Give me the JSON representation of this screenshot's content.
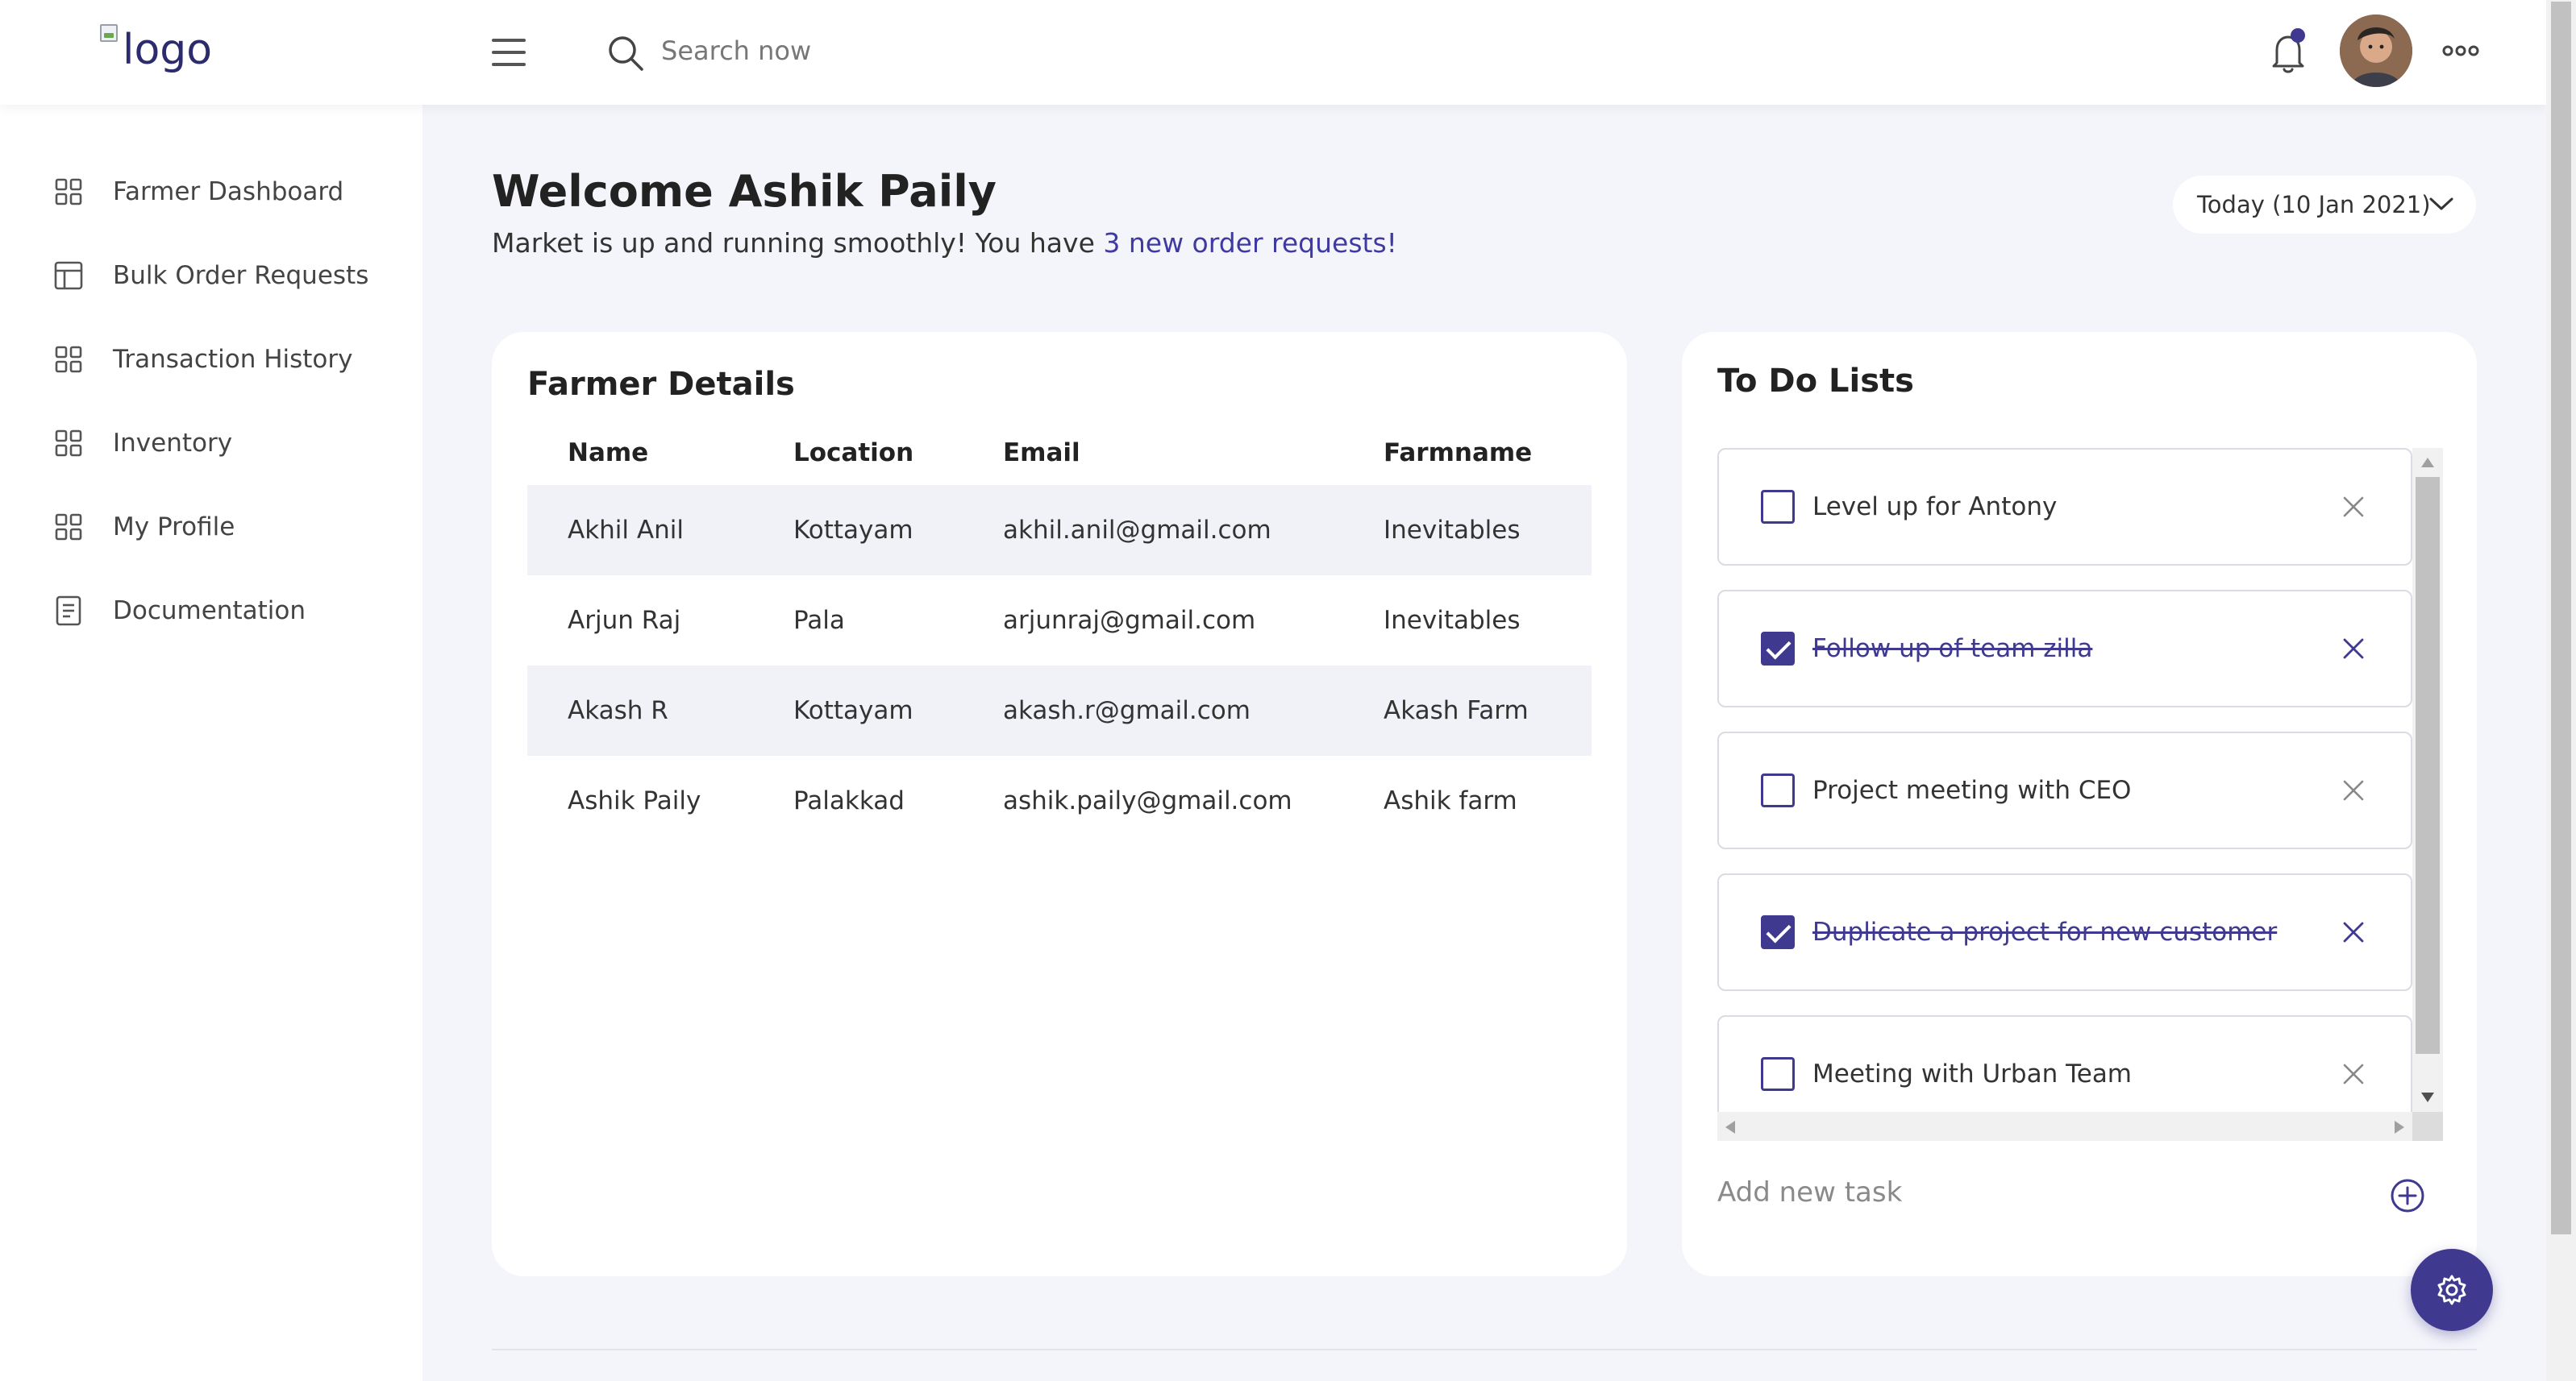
{
  "header": {
    "logo_alt": "logo",
    "search_placeholder": "Search now"
  },
  "sidebar": {
    "items": [
      {
        "label": "Farmer Dashboard",
        "icon": "grid-icon"
      },
      {
        "label": "Bulk Order Requests",
        "icon": "layout-icon"
      },
      {
        "label": "Transaction History",
        "icon": "grid-icon"
      },
      {
        "label": "Inventory",
        "icon": "grid-icon"
      },
      {
        "label": "My Profile",
        "icon": "grid-icon"
      },
      {
        "label": "Documentation",
        "icon": "document-icon"
      }
    ]
  },
  "main": {
    "welcome": "Welcome Ashik Paily",
    "subtitle_prefix": "Market is up and running smoothly! You have ",
    "subtitle_link": "3 new order requests!",
    "date_label": "Today (10 Jan 2021)"
  },
  "farmer_details": {
    "title": "Farmer Details",
    "columns": [
      "Name",
      "Location",
      "Email",
      "Farmname"
    ],
    "rows": [
      [
        "Akhil Anil",
        "Kottayam",
        "akhil.anil@gmail.com",
        "Inevitables"
      ],
      [
        "Arjun Raj",
        "Pala",
        "arjunraj@gmail.com",
        "Inevitables"
      ],
      [
        "Akash R",
        "Kottayam",
        "akash.r@gmail.com",
        "Akash Farm"
      ],
      [
        "Ashik Paily",
        "Palakkad",
        "ashik.paily@gmail.com",
        "Ashik farm"
      ]
    ]
  },
  "todo": {
    "title": "To Do Lists",
    "items": [
      {
        "text": "Level up for Antony",
        "done": false
      },
      {
        "text": "Follow up of team zilla",
        "done": true
      },
      {
        "text": "Project meeting with CEO",
        "done": false
      },
      {
        "text": "Duplicate a project for new customer",
        "done": true
      },
      {
        "text": "Meeting with Urban Team",
        "done": false
      }
    ],
    "add_placeholder": "Add new task"
  },
  "colors": {
    "accent": "#3f3a8f",
    "link": "#3f3aa3",
    "background": "#f4f5fa",
    "row_shade": "#f1f2f8"
  }
}
